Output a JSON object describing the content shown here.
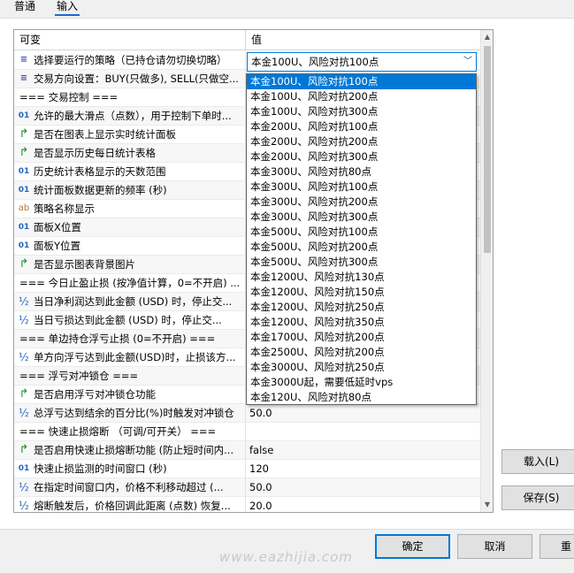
{
  "tabs": [
    "普通",
    "输入"
  ],
  "active_tab": 1,
  "grid": {
    "col_name": "可变",
    "col_value": "值",
    "rows": [
      {
        "icon": "enum",
        "name": "选择要运行的策略（已持仓请勿切换切略）",
        "value": ""
      },
      {
        "icon": "enum",
        "name": "交易方向设置：BUY(只做多), SELL(只做空...",
        "value": ""
      },
      {
        "icon": "none",
        "name": "=== 交易控制 ===",
        "value": ""
      },
      {
        "icon": "int",
        "name": "允许的最大滑点（点数），用于控制下单时...",
        "value": ""
      },
      {
        "icon": "bool",
        "name": "是否在图表上显示实时统计面板",
        "value": ""
      },
      {
        "icon": "bool",
        "name": "是否显示历史每日统计表格",
        "value": ""
      },
      {
        "icon": "int",
        "name": "历史统计表格显示的天数范围",
        "value": ""
      },
      {
        "icon": "int",
        "name": "统计面板数据更新的频率 (秒)",
        "value": ""
      },
      {
        "icon": "str",
        "name": "策略名称显示",
        "value": ""
      },
      {
        "icon": "int",
        "name": "面板X位置",
        "value": ""
      },
      {
        "icon": "int",
        "name": "面板Y位置",
        "value": ""
      },
      {
        "icon": "bool",
        "name": "是否显示图表背景图片",
        "value": ""
      },
      {
        "icon": "none",
        "name": "=== 今日止盈止损 (按净值计算，0=不开启) ...",
        "value": ""
      },
      {
        "icon": "dbl",
        "name": "当日净利润达到此金额 (USD) 时，停止交...",
        "value": ""
      },
      {
        "icon": "dbl",
        "name": "当日亏损达到此金额 (USD) 时，停止交...",
        "value": ""
      },
      {
        "icon": "none",
        "name": "=== 单边持仓浮亏止损 (0=不开启) ===",
        "value": ""
      },
      {
        "icon": "dbl",
        "name": "单方向浮亏达到此金额(USD)时，止损该方...",
        "value": ""
      },
      {
        "icon": "none",
        "name": "=== 浮亏对冲锁仓 ===",
        "value": ""
      },
      {
        "icon": "bool",
        "name": "是否启用浮亏对冲锁仓功能",
        "value": ""
      },
      {
        "icon": "dbl",
        "name": "总浮亏达到结余的百分比(%)时触发对冲锁仓",
        "value": "50.0"
      },
      {
        "icon": "none",
        "name": "=== 快速止损熔断 （可调/可开关） ===",
        "value": ""
      },
      {
        "icon": "bool",
        "name": "是否启用快速止损熔断功能 (防止短时间内...",
        "value": "false"
      },
      {
        "icon": "int",
        "name": "快速止损监测的时间窗口 (秒)",
        "value": "120"
      },
      {
        "icon": "dbl",
        "name": "在指定时间窗口内，价格不利移动超过 (...",
        "value": "50.0"
      },
      {
        "icon": "dbl",
        "name": "熔断触发后，价格回调此距离 (点数) 恢复...",
        "value": "20.0"
      }
    ]
  },
  "combo": {
    "value": "本金100U、风险对抗100点"
  },
  "dropdown": {
    "selected_index": 0,
    "options": [
      "本金100U、风险对抗100点",
      "本金100U、风险对抗200点",
      "本金100U、风险对抗300点",
      "本金200U、风险对抗100点",
      "本金200U、风险对抗200点",
      "本金200U、风险对抗300点",
      "本金300U、风险对抗80点",
      "本金300U、风险对抗100点",
      "本金300U、风险对抗200点",
      "本金300U、风险对抗300点",
      "本金500U、风险对抗100点",
      "本金500U、风险对抗200点",
      "本金500U、风险对抗300点",
      "本金1200U、风险对抗130点",
      "本金1200U、风险对抗150点",
      "本金1200U、风险对抗250点",
      "本金1200U、风险对抗350点",
      "本金1700U、风险对抗200点",
      "本金2500U、风险对抗200点",
      "本金3000U、风险对抗250点",
      "本金3000U起，需要低延时vps",
      "本金120U、风险对抗80点"
    ]
  },
  "buttons": {
    "load": "载入(L)",
    "save": "保存(S)",
    "ok": "确定",
    "cancel": "取消",
    "reset": "重"
  },
  "icons": {
    "enum": "enum-icon",
    "int": "integer-icon",
    "bool": "boolean-icon",
    "dbl": "double-icon",
    "str": "string-icon"
  },
  "watermark": "www.eazhijia.com",
  "colors": {
    "accent": "#0078d7",
    "selection": "#0078d7"
  }
}
